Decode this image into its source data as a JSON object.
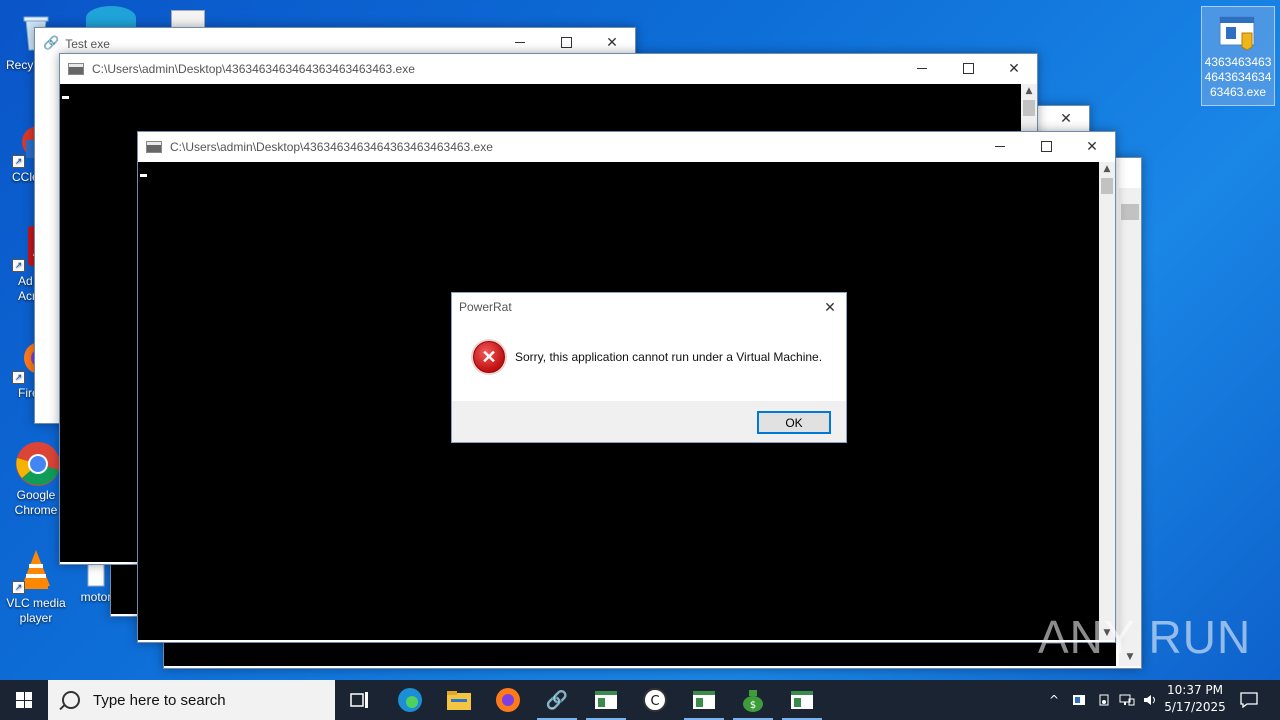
{
  "desktop": {
    "icons": [
      {
        "label": "Recy",
        "icon": "recycle-bin-icon"
      },
      {
        "label": "CCle",
        "icon": "ccleaner-icon"
      },
      {
        "label": "Ad Acr",
        "icon": "acrobat-icon"
      },
      {
        "label": "Fire",
        "icon": "firefox-icon"
      },
      {
        "label": "Google Chrome",
        "icon": "chrome-icon"
      },
      {
        "label": "VLC media player",
        "icon": "vlc-icon"
      },
      {
        "label": "motor",
        "icon": "file-icon"
      }
    ],
    "selected_file": {
      "label": "4363463463464363463463463.exe",
      "icon": "exe-file-icon"
    }
  },
  "windows": {
    "test_exe": {
      "title": "Test exe"
    },
    "console_back": {
      "title": "C:\\Users\\admin\\Desktop\\4363463463464363463463463.exe"
    },
    "console_front": {
      "title": "C:\\Users\\admin\\Desktop\\4363463463464363463463463.exe"
    }
  },
  "dialog": {
    "title": "PowerRat",
    "message": "Sorry, this application cannot run under a Virtual Machine.",
    "ok_label": "OK",
    "icon": "error-icon"
  },
  "taskbar": {
    "search_placeholder": "Type here to search",
    "time": "10:37 PM",
    "date": "5/17/2025",
    "apps": [
      "task-view-icon",
      "edge-icon",
      "file-explorer-icon",
      "firefox-icon",
      "link-app-icon",
      "console-app-icon",
      "ccleaner-icon",
      "console-app-icon",
      "money-bag-icon",
      "console-app-icon"
    ]
  },
  "watermark": "ANY RUN",
  "colors": {
    "desktop": "#0e6fd8",
    "taskbar": "#1b2433",
    "accent": "#0078d7"
  }
}
